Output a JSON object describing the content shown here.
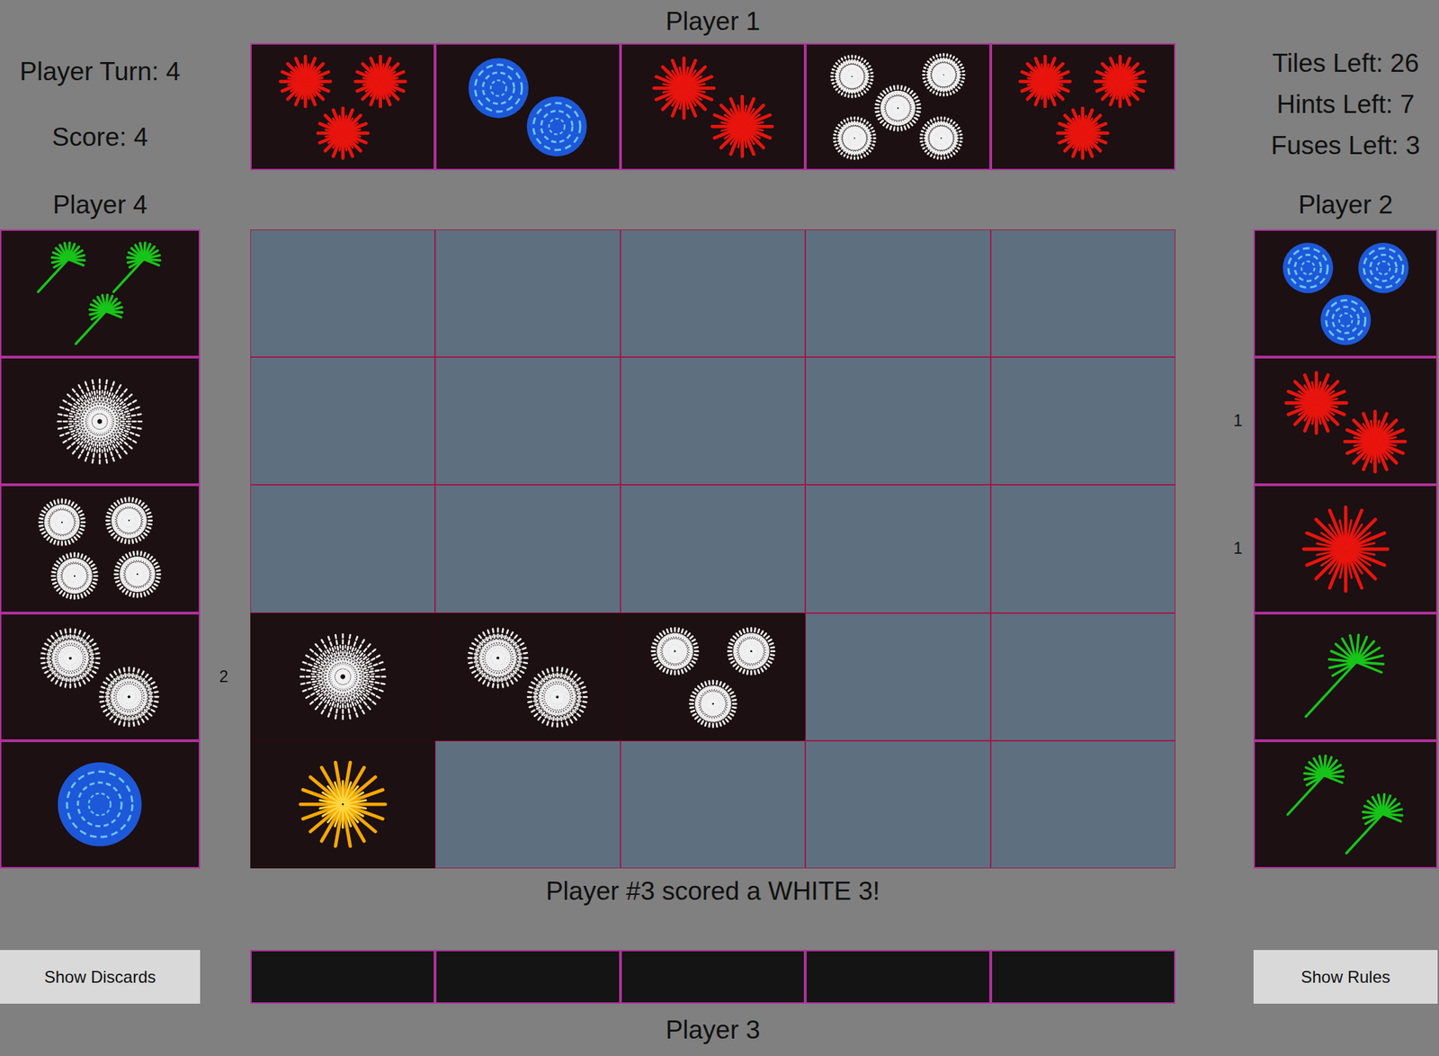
{
  "labels": {
    "top": "Player 1",
    "left": "Player 4",
    "right": "Player 2",
    "bottom": "Player 3"
  },
  "left_info": [
    "Player Turn: 4",
    "Score: 4"
  ],
  "right_info": [
    "Tiles Left: 26",
    "Hints Left: 7",
    "Fuses Left: 3"
  ],
  "top_hand": [
    {
      "face_up": true,
      "count": 3,
      "color": "#e8140e",
      "kind": "peony",
      "hint": ""
    },
    {
      "face_up": true,
      "count": 2,
      "color": "#1d58d8",
      "kind": "swirl",
      "hint": ""
    },
    {
      "face_up": true,
      "count": 2,
      "color": "#e8140e",
      "kind": "peony",
      "hint": ""
    },
    {
      "face_up": true,
      "count": 5,
      "color": "#f0f0f0",
      "kind": "chrysanthemum",
      "hint": ""
    },
    {
      "face_up": true,
      "count": 3,
      "color": "#e8140e",
      "kind": "peony",
      "hint": ""
    }
  ],
  "left_hand": [
    {
      "face_up": true,
      "count": 3,
      "color": "#18c41a",
      "kind": "palm",
      "hint": ""
    },
    {
      "face_up": true,
      "count": 1,
      "color": "#f0f0f0",
      "kind": "chrysanthemum",
      "hint": ""
    },
    {
      "face_up": true,
      "count": 4,
      "color": "#f0f0f0",
      "kind": "chrysanthemum",
      "hint": ""
    },
    {
      "face_up": true,
      "count": 2,
      "color": "#f0f0f0",
      "kind": "chrysanthemum",
      "hint": "2"
    },
    {
      "face_up": true,
      "count": 1,
      "color": "#1d58d8",
      "kind": "swirl",
      "hint": ""
    }
  ],
  "right_hand": [
    {
      "face_up": true,
      "count": 3,
      "color": "#1d58d8",
      "kind": "swirl",
      "hint": ""
    },
    {
      "face_up": true,
      "count": 2,
      "color": "#e8140e",
      "kind": "peony",
      "hint": "1"
    },
    {
      "face_up": true,
      "count": 1,
      "color": "#e8140e",
      "kind": "peony",
      "hint": "1"
    },
    {
      "face_up": true,
      "count": 1,
      "color": "#18c41a",
      "kind": "palm",
      "hint": ""
    },
    {
      "face_up": true,
      "count": 2,
      "color": "#18c41a",
      "kind": "palm",
      "hint": ""
    }
  ],
  "bottom_hand": [
    {
      "face_up": false,
      "hint": ""
    },
    {
      "face_up": false,
      "hint": ""
    },
    {
      "face_up": false,
      "hint": ""
    },
    {
      "face_up": false,
      "hint": ""
    },
    {
      "face_up": false,
      "hint": ""
    }
  ],
  "board": {
    "rows": [
      [
        {
          "filled": false
        },
        {
          "filled": false
        },
        {
          "filled": false
        },
        {
          "filled": false
        },
        {
          "filled": false
        }
      ],
      [
        {
          "filled": false
        },
        {
          "filled": false
        },
        {
          "filled": false
        },
        {
          "filled": false
        },
        {
          "filled": false
        }
      ],
      [
        {
          "filled": false
        },
        {
          "filled": false
        },
        {
          "filled": false
        },
        {
          "filled": false
        },
        {
          "filled": false
        }
      ],
      [
        {
          "filled": true,
          "count": 1,
          "color": "#f0f0f0",
          "kind": "chrysanthemum"
        },
        {
          "filled": true,
          "count": 2,
          "color": "#f0f0f0",
          "kind": "chrysanthemum"
        },
        {
          "filled": true,
          "count": 3,
          "color": "#f0f0f0",
          "kind": "chrysanthemum"
        },
        {
          "filled": false
        },
        {
          "filled": false
        }
      ],
      [
        {
          "filled": true,
          "count": 1,
          "color": "#f7a800",
          "kind": "burst"
        },
        {
          "filled": false
        },
        {
          "filled": false
        },
        {
          "filled": false
        },
        {
          "filled": false
        }
      ]
    ]
  },
  "message": "Player #3 scored a WHITE 3!",
  "buttons": {
    "discards": "Show Discards",
    "rules": "Show Rules"
  }
}
